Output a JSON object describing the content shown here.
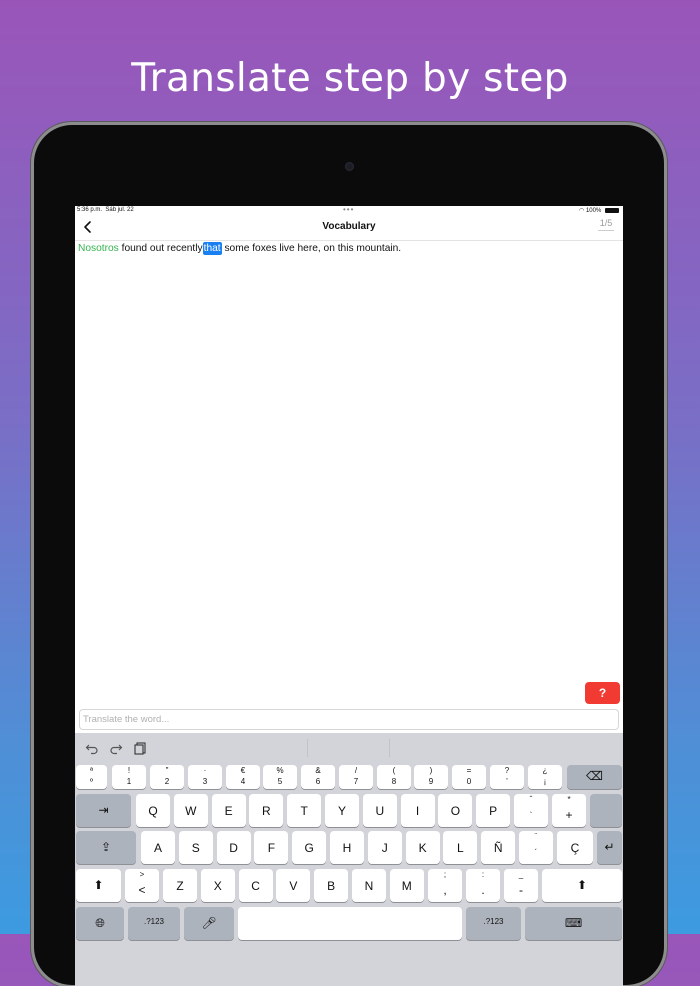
{
  "headline": "Translate step by step",
  "status_bar": {
    "time": "5:36 p.m.",
    "date": "Sáb jul. 22",
    "battery": "100%"
  },
  "nav": {
    "title": "Vocabulary",
    "progress": "1/5"
  },
  "sentence": {
    "known_word": "Nosotros",
    "text_before": "found out recently",
    "current_word": "that",
    "text_after": "some foxes live here, on this mountain."
  },
  "hint_button": "?",
  "input": {
    "placeholder": "Translate the word...",
    "value": ""
  },
  "keyboard": {
    "number_row": [
      {
        "top": "ª",
        "bot": "º"
      },
      {
        "top": "!",
        "bot": "1"
      },
      {
        "top": "\"",
        "bot": "2"
      },
      {
        "top": "·",
        "bot": "3"
      },
      {
        "top": "€",
        "bot": "4"
      },
      {
        "top": "%",
        "bot": "5"
      },
      {
        "top": "&",
        "bot": "6"
      },
      {
        "top": "/",
        "bot": "7"
      },
      {
        "top": "(",
        "bot": "8"
      },
      {
        "top": ")",
        "bot": "9"
      },
      {
        "top": "=",
        "bot": "0"
      },
      {
        "top": "?",
        "bot": "'"
      },
      {
        "top": "¿",
        "bot": "¡"
      }
    ],
    "row1": [
      "Q",
      "W",
      "E",
      "R",
      "T",
      "Y",
      "U",
      "I",
      "O",
      "P"
    ],
    "row1_extra": [
      {
        "top": "ˆ",
        "bot": "`"
      },
      {
        "top": "*",
        "bot": "+"
      }
    ],
    "row2": [
      "A",
      "S",
      "D",
      "F",
      "G",
      "H",
      "J",
      "K",
      "L",
      "Ñ"
    ],
    "row2_extra": [
      {
        "top": "¨",
        "bot": "´"
      },
      {
        "top": "",
        "bot": "Ç"
      }
    ],
    "row3_left": {
      "top": ">",
      "bot": "<"
    },
    "row3": [
      "Z",
      "X",
      "C",
      "V",
      "B",
      "N",
      "M"
    ],
    "row3_extra": [
      {
        "top": ";",
        "bot": ","
      },
      {
        "top": ":",
        "bot": "."
      },
      {
        "top": "_",
        "bot": "-"
      }
    ],
    "mode_key": ".?123",
    "mode_key_right": ".?123",
    "space": ""
  },
  "icons": [
    "back-icon",
    "undo-icon",
    "redo-icon",
    "paste-icon",
    "delete-icon",
    "tab-icon",
    "capslock-icon",
    "return-icon",
    "shift-icon",
    "globe-icon",
    "mic-icon",
    "hide-keyboard-icon"
  ]
}
